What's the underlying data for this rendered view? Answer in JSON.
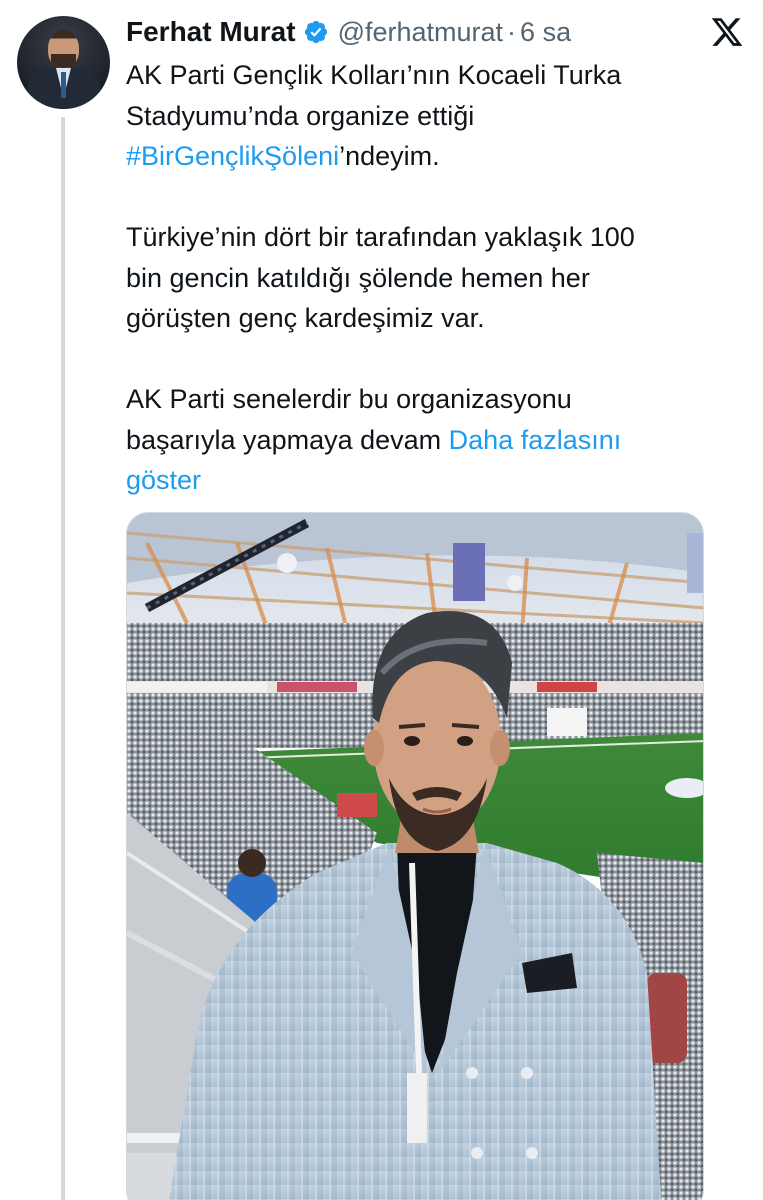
{
  "author": {
    "display_name": "Ferhat Murat",
    "handle": "@ferhatmurat",
    "separator": "·",
    "time_ago": "6 sa",
    "verified": true
  },
  "brand": {
    "logo": "x-logo-icon"
  },
  "tweet": {
    "p1_before": "AK Parti Gençlik Kolları’nın Kocaeli Turka",
    "p1_line2": "Stadyumu’nda organize ettiği",
    "p1_hashtag": "#BirGençlikŞöleni",
    "p1_after": "’ndeyim.",
    "p2_line1": "Türkiye’nin dört bir tarafından yaklaşık 100",
    "p2_line2": "bin gencin katıldığı şölende hemen her",
    "p2_line3": "görüşten genç kardeşimiz var.",
    "p3_line1": "AK Parti senelerdir bu organizasyonu",
    "p3_line2": "başarıyla yapmaya devam",
    "show_more_part1": "Daha fazlasını",
    "show_more_part2": "göster"
  },
  "colors": {
    "link": "#1d9bf0",
    "verified_badge": "#1d9bf0",
    "secondary_text": "#536471",
    "thread_line": "#cfd9de"
  }
}
